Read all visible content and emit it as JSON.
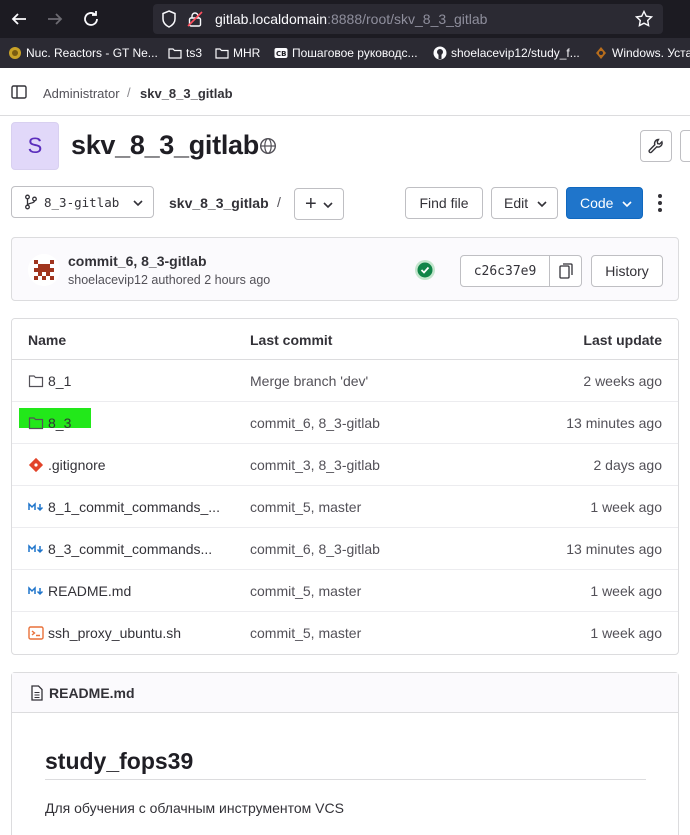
{
  "browser": {
    "url_host": "gitlab.localdomain",
    "url_path": ":8888/root/skv_8_3_gitlab",
    "bookmarks": [
      {
        "label": "Nuc. Reactors - GT Ne...",
        "icon": "globe-icon"
      },
      {
        "label": "ts3",
        "icon": "folder-icon"
      },
      {
        "label": "MHR",
        "icon": "folder-icon"
      },
      {
        "label": "Пошаговое руководс...",
        "icon": "cb-icon"
      },
      {
        "label": "shoelacevip12/study_f...",
        "icon": "github-icon"
      },
      {
        "label": "Windows. Уста",
        "icon": "windows-icon"
      }
    ]
  },
  "breadcrumb": {
    "parent": "Administrator",
    "separator": "/",
    "current": "skv_8_3_gitlab"
  },
  "project": {
    "avatar_letter": "S",
    "title": "skv_8_3_gitlab"
  },
  "toolbar": {
    "branch": "8_3-gitlab",
    "path_root": "skv_8_3_gitlab",
    "path_sep": "/",
    "plus": "+",
    "find_file": "Find file",
    "edit": "Edit",
    "code": "Code"
  },
  "last_commit": {
    "title": "commit_6, 8_3-gitlab",
    "meta": "shoelacevip12 authored 2 hours ago",
    "sha": "c26c37e9",
    "history": "History",
    "status_color": "#108548"
  },
  "files": {
    "headers": {
      "name": "Name",
      "last_commit": "Last commit",
      "last_update": "Last update"
    },
    "rows": [
      {
        "name": "8_1",
        "type": "folder",
        "commit": "Merge branch 'dev'",
        "updated": "2 weeks ago"
      },
      {
        "name": "8_3",
        "type": "folder",
        "commit": "commit_6, 8_3-gitlab",
        "updated": "13 minutes ago",
        "highlight": "#22e81a"
      },
      {
        "name": ".gitignore",
        "type": "git",
        "commit": "commit_3, 8_3-gitlab",
        "updated": "2 days ago"
      },
      {
        "name": "8_1_commit_commands_...",
        "type": "markdown",
        "commit": "commit_5, master",
        "updated": "1 week ago"
      },
      {
        "name": "8_3_commit_commands...",
        "type": "markdown",
        "commit": "commit_6, 8_3-gitlab",
        "updated": "13 minutes ago"
      },
      {
        "name": "README.md",
        "type": "markdown",
        "commit": "commit_5, master",
        "updated": "1 week ago"
      },
      {
        "name": "ssh_proxy_ubuntu.sh",
        "type": "shell",
        "commit": "commit_5, master",
        "updated": "1 week ago"
      }
    ]
  },
  "readme": {
    "filename": "README.md",
    "heading": "study_fops39",
    "text": "Для обучения с облачным инструментом VCS"
  },
  "colors": {
    "primary": "#1f75cb",
    "success": "#108548",
    "highlight": "#22e81a"
  }
}
